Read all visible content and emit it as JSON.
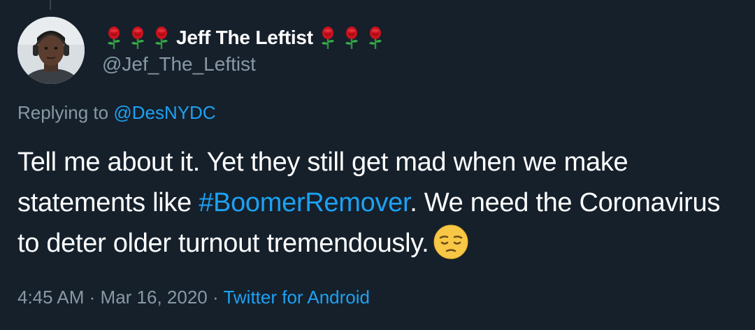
{
  "author": {
    "display_name": "Jeff The Leftist",
    "handle": "@Jef_The_Leftist",
    "name_prefix_icons": [
      "rose-icon",
      "rose-icon",
      "rose-icon"
    ],
    "name_suffix_icons": [
      "rose-icon",
      "rose-icon",
      "rose-icon"
    ]
  },
  "reply": {
    "prefix": "Replying to",
    "mention": "@DesNYDC"
  },
  "tweet": {
    "text_part1": "Tell me about it. Yet they still get mad when we make statements like ",
    "hashtag": "#BoomerRemover",
    "text_part2": ". We need the Coronavirus to deter older turnout tremendously.",
    "emoji": "pensive-face-icon"
  },
  "meta": {
    "time": "4:45 AM",
    "separator1": "·",
    "date": "Mar 16, 2020",
    "separator2": "·",
    "source": "Twitter for Android"
  },
  "colors": {
    "background": "#15202b",
    "text": "#ffffff",
    "secondary": "#8899a6",
    "link": "#1da1f2"
  }
}
